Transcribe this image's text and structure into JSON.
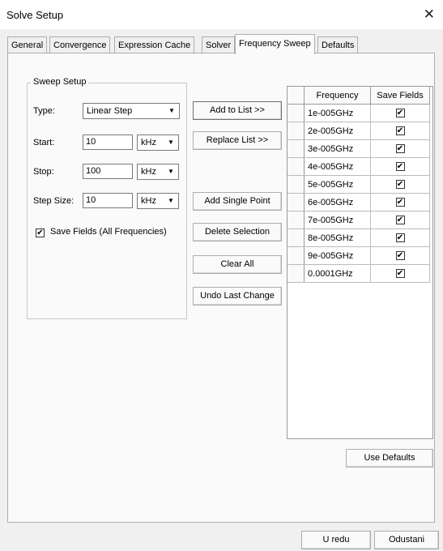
{
  "window": {
    "title": "Solve Setup",
    "close_glyph": "✕"
  },
  "tabs": [
    {
      "label": "General"
    },
    {
      "label": "Convergence"
    },
    {
      "label": "Expression Cache"
    },
    {
      "label": "Solver"
    },
    {
      "label": "Frequency Sweep"
    },
    {
      "label": "Defaults"
    }
  ],
  "active_tab": "Frequency Sweep",
  "sweep_setup": {
    "title": "Sweep Setup",
    "type_label": "Type:",
    "type_value": "Linear Step",
    "start_label": "Start:",
    "start_value": "10",
    "start_unit": "kHz",
    "stop_label": "Stop:",
    "stop_value": "100",
    "stop_unit": "kHz",
    "step_label": "Step Size:",
    "step_value": "10",
    "step_unit": "kHz",
    "save_fields_label": "Save Fields (All Frequencies)",
    "save_fields_checked": true
  },
  "buttons": {
    "add_to_list": "Add to List >>",
    "replace_list": "Replace List >>",
    "add_single_point": "Add Single Point",
    "delete_selection": "Delete Selection",
    "clear_all": "Clear All",
    "undo_last_change": "Undo Last Change",
    "use_defaults": "Use Defaults",
    "ok": "U redu",
    "cancel": "Odustani"
  },
  "table": {
    "columns": [
      "Frequency",
      "Save Fields"
    ],
    "rows": [
      {
        "frequency": "1e-005GHz",
        "save": true
      },
      {
        "frequency": "2e-005GHz",
        "save": true
      },
      {
        "frequency": "3e-005GHz",
        "save": true
      },
      {
        "frequency": "4e-005GHz",
        "save": true
      },
      {
        "frequency": "5e-005GHz",
        "save": true
      },
      {
        "frequency": "6e-005GHz",
        "save": true
      },
      {
        "frequency": "7e-005GHz",
        "save": true
      },
      {
        "frequency": "8e-005GHz",
        "save": true
      },
      {
        "frequency": "9e-005GHz",
        "save": true
      },
      {
        "frequency": "0.0001GHz",
        "save": true
      }
    ]
  },
  "icons": {
    "checkbox_check": "✔",
    "dropdown": "▼"
  }
}
